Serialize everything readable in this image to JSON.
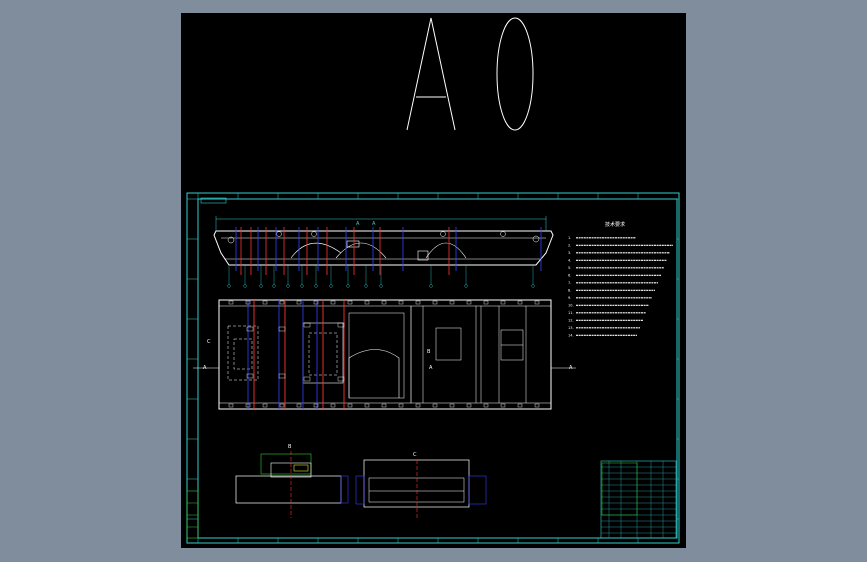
{
  "sheet": {
    "size_label": "A0",
    "view_labels": {
      "section_top_left": "A",
      "section_top_right": "A",
      "left_marker": "A",
      "right_marker": "A",
      "mid_marker": "A",
      "b_marker": "B",
      "c_marker": "C",
      "side_view_label": "B",
      "front_view_label": "C"
    }
  },
  "tech_notes": {
    "title": "技术要求",
    "lines": [
      "1.",
      "2.",
      "3.",
      "4.",
      "5.",
      "6.",
      "7.",
      "8.",
      "9.",
      "10.",
      "11.",
      "12.",
      "13.",
      "14."
    ]
  },
  "colors": {
    "background": "#000000",
    "frame": "#2fd0d0",
    "outline": "#ffffff",
    "dims": "#2fd0d0",
    "section_red": "#ff3030",
    "hidden_blue": "#3040ff",
    "notes": "#ffffff",
    "title_block": "#2fd0d0",
    "green": "#30d030",
    "yellow": "#e0e030"
  }
}
